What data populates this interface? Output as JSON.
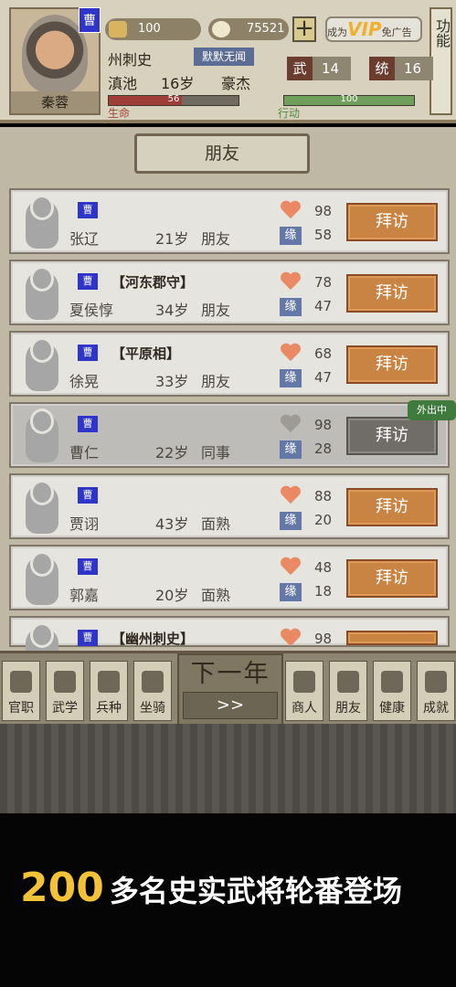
{
  "header": {
    "portrait_name": "秦蓉",
    "faction": "曹",
    "gold": "100",
    "copper": "75521",
    "vip_prefix": "成为",
    "vip_text": "VIP",
    "vip_suffix": "免广告",
    "function_label": "功能",
    "title": "州刺史",
    "tag": "默默无闻",
    "location": "滇池",
    "age": "16岁",
    "trait": "豪杰",
    "wu_label": "武",
    "wu_value": "14",
    "tong_label": "统",
    "tong_value": "16",
    "hp_label": "生命",
    "hp_value": "56",
    "hp_ratio": 0.56,
    "action_label": "行动",
    "action_value": "100",
    "action_ratio": 1
  },
  "main": {
    "title": "朋友",
    "outside_badge": "外出中",
    "rows": [
      {
        "faction": "曹",
        "title": "",
        "name": "张辽",
        "age": "21岁",
        "relation": "朋友",
        "affection": "98",
        "fate": "58",
        "button": "拜访",
        "state": "active"
      },
      {
        "faction": "曹",
        "title": "【河东郡守】",
        "name": "夏侯惇",
        "age": "34岁",
        "relation": "朋友",
        "affection": "78",
        "fate": "47",
        "button": "拜访",
        "state": "active"
      },
      {
        "faction": "曹",
        "title": "【平原相】",
        "name": "徐晃",
        "age": "33岁",
        "relation": "朋友",
        "affection": "68",
        "fate": "47",
        "button": "拜访",
        "state": "active"
      },
      {
        "faction": "曹",
        "title": "",
        "name": "曹仁",
        "age": "22岁",
        "relation": "同事",
        "affection": "98",
        "fate": "28",
        "button": "拜访",
        "state": "disabled"
      },
      {
        "faction": "曹",
        "title": "",
        "name": "贾诩",
        "age": "43岁",
        "relation": "面熟",
        "affection": "88",
        "fate": "20",
        "button": "拜访",
        "state": "active"
      },
      {
        "faction": "曹",
        "title": "",
        "name": "郭嘉",
        "age": "20岁",
        "relation": "面熟",
        "affection": "48",
        "fate": "18",
        "button": "拜访",
        "state": "active"
      },
      {
        "faction": "曹",
        "title": "【幽州刺史】",
        "name": "",
        "age": "",
        "relation": "",
        "affection": "98",
        "fate": "",
        "button": "",
        "state": "partial"
      }
    ]
  },
  "nav": {
    "items": [
      "官职",
      "武学",
      "兵种",
      "坐骑",
      "商人",
      "朋友",
      "健康",
      "成就"
    ],
    "next_title": "下一年",
    "next_button": ">>"
  },
  "banner": {
    "number": "200",
    "text": "多名史实武将轮番登场"
  },
  "icons": [
    "gold-ingot-icon",
    "copper-coin-icon",
    "plus-icon",
    "heart-icon",
    "fate-icon",
    "avatar-silhouette-icon",
    "nav-icon"
  ]
}
